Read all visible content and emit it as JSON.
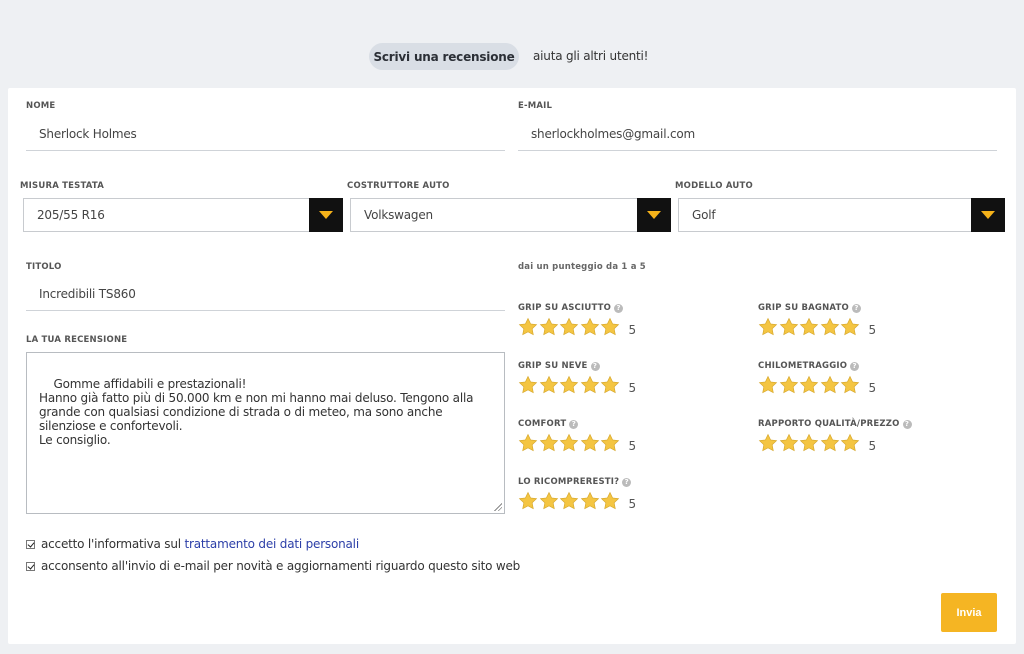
{
  "header": {
    "pill": "Scrivi una recensione",
    "subtitle": "aiuta gli altri utenti!"
  },
  "form": {
    "nome": {
      "label": "NOME",
      "value": "Sherlock Holmes"
    },
    "email": {
      "label": "E-MAIL",
      "value": "sherlockholmes@gmail.com"
    },
    "misura": {
      "label": "MISURA TESTATA",
      "value": "205/55 R16"
    },
    "costruttore": {
      "label": "COSTRUTTORE AUTO",
      "value": "Volkswagen"
    },
    "modello": {
      "label": "MODELLO AUTO",
      "value": "Golf"
    },
    "titolo": {
      "label": "TITOLO",
      "value": "Incredibili TS860"
    },
    "recensione": {
      "label": "LA TUA RECENSIONE",
      "value": "Gomme affidabili e prestazionali!\nHanno già fatto più di 50.000 km e non mi hanno mai deluso. Tengono alla grande con qualsiasi condizione di strada o di meteo, ma sono anche silenziose e confortevoli.\nLe consiglio."
    },
    "rating_hint": "dai un punteggio da 1 a 5",
    "ratings": [
      {
        "label": "GRIP SU ASCIUTTO",
        "value": 5,
        "value_text": "5"
      },
      {
        "label": "GRIP SU BAGNATO",
        "value": 5,
        "value_text": "5"
      },
      {
        "label": "GRIP SU NEVE",
        "value": 5,
        "value_text": "5"
      },
      {
        "label": "CHILOMETRAGGIO",
        "value": 5,
        "value_text": "5"
      },
      {
        "label": "COMFORT",
        "value": 5,
        "value_text": "5"
      },
      {
        "label": "RAPPORTO QUALITÀ/PREZZO",
        "value": 5,
        "value_text": "5"
      },
      {
        "label": "LO RICOMPRERESTI?",
        "value": 5,
        "value_text": "5"
      }
    ],
    "consent1": {
      "checked": true,
      "prefix": "accetto l'informativa sul ",
      "link": "trattamento dei dati personali"
    },
    "consent2": {
      "checked": true,
      "text": "acconsento all'invio di e-mail per novità e aggiornamenti riguardo questo sito web"
    },
    "submit": "Invia"
  },
  "colors": {
    "accent": "#f5b523",
    "star": "#f4c542",
    "link": "#2c3fa8",
    "dark": "#111111"
  },
  "icons": {
    "info": "info-icon",
    "star": "star-icon",
    "dropdown": "chevron-down-icon",
    "check": "check-icon"
  }
}
